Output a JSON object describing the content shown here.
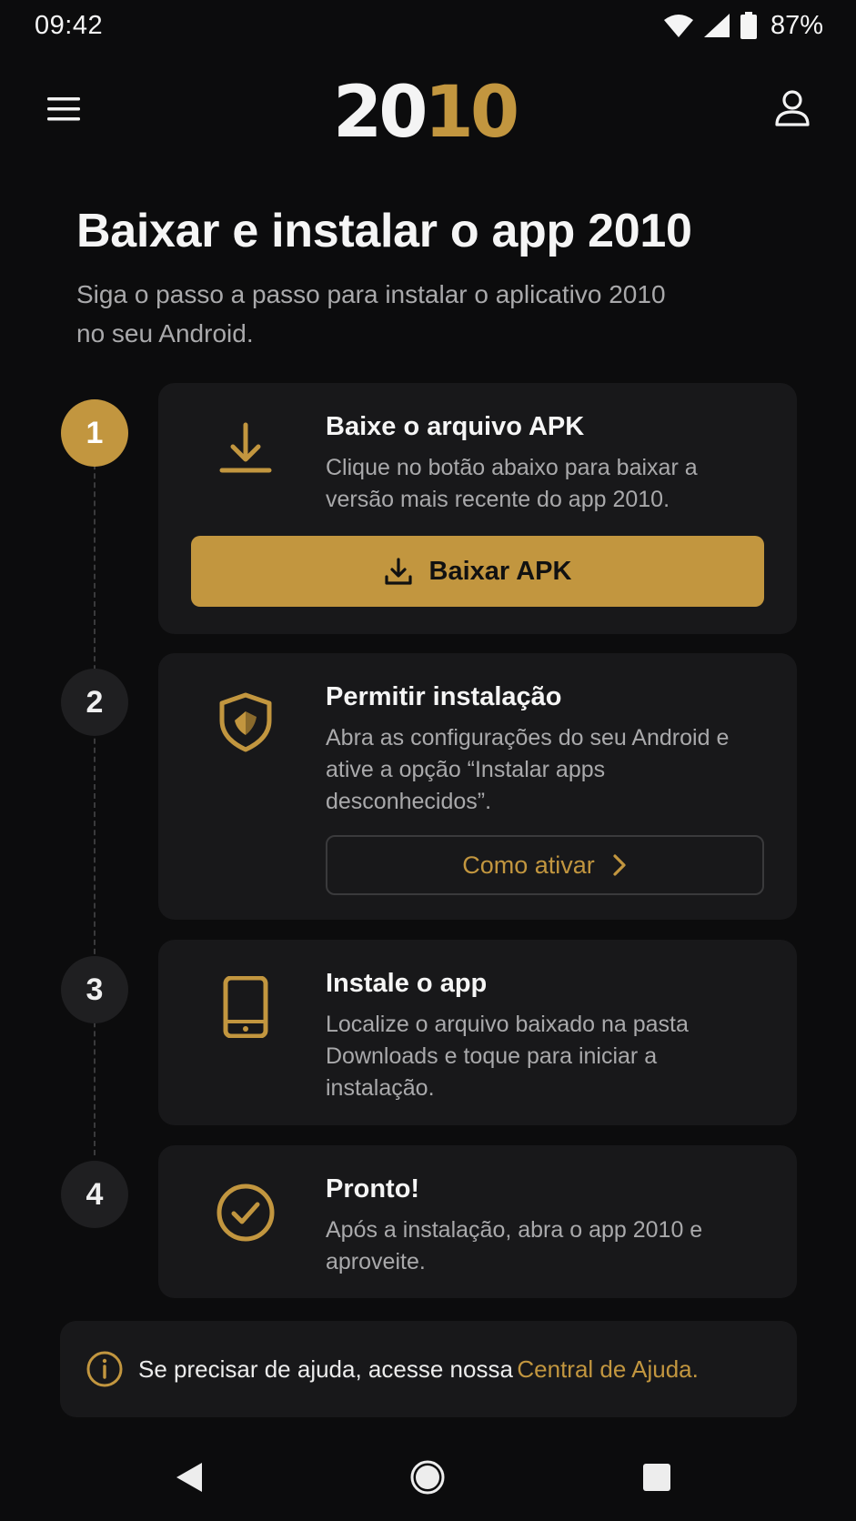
{
  "status_bar": {
    "time": "09:42",
    "battery": "87%",
    "icons": [
      "wifi-icon",
      "signal-icon",
      "battery-icon"
    ]
  },
  "header": {
    "logo_white": "20",
    "logo_gold": "10",
    "menu_icon": "menu-icon",
    "profile_icon": "user-icon"
  },
  "page": {
    "title": "Baixar e instalar o app 2010",
    "subtitle": "Siga o passo a passo para instalar o aplicativo 2010 no seu Android."
  },
  "steps": [
    {
      "number": "1",
      "icon": "download-icon",
      "title": "Baixe o arquivo APK",
      "text": "Clique no botão abaixo para baixar a versão mais recente do app 2010.",
      "button_label": "Baixar APK"
    },
    {
      "number": "2",
      "icon": "shield-icon",
      "title": "Permitir instalação",
      "text": "Abra as configurações do seu Android e ative a opção “Instalar apps desconhecidos”.",
      "button_label": "Como ativar"
    },
    {
      "number": "3",
      "icon": "phone-icon",
      "title": "Instale o app",
      "text": "Localize o arquivo baixado na pasta Downloads e toque para iniciar a instalação."
    },
    {
      "number": "4",
      "icon": "check-circle-icon",
      "title": "Pronto!",
      "text": "Após a instalação, abra o app 2010 e aproveite."
    }
  ],
  "help": {
    "text": "Se precisar de ajuda, acesse nossa",
    "link": "Central de Ajuda."
  },
  "colors": {
    "accent": "#c2963f",
    "background": "#0c0c0d",
    "card": "#18181a",
    "muted_text": "#a9a9ab"
  }
}
